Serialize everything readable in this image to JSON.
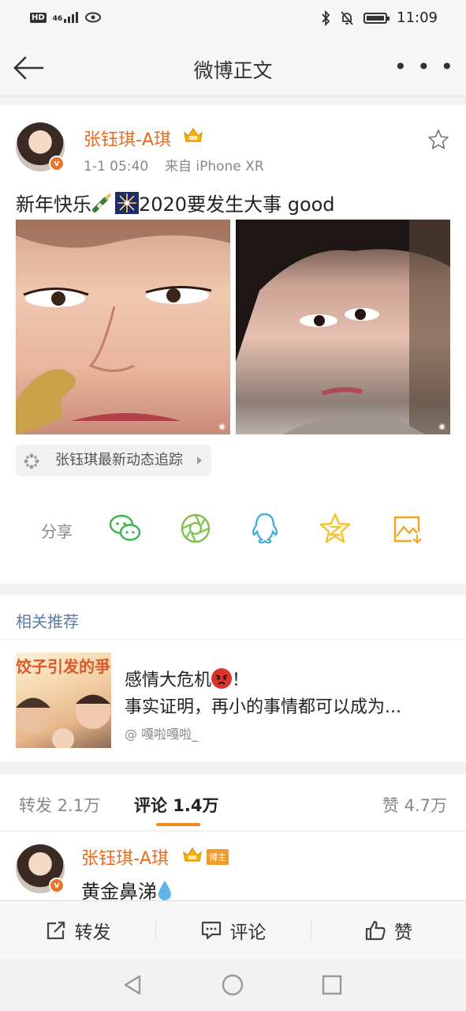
{
  "status_bar": {
    "network": "HD",
    "signal": "46",
    "time": "11:09"
  },
  "nav": {
    "title": "微博正文",
    "more": "• • •"
  },
  "post": {
    "username": "张钰琪-A琪",
    "time": "1-1 05:40",
    "source": "来自 iPhone XR",
    "text_before": "新年快乐",
    "text_after": "2020要发生大事 good",
    "super_topic": "张钰琪最新动态追踪",
    "share_label": "分享",
    "share_icons": [
      "wechat-icon",
      "moments-icon",
      "qq-icon",
      "qzone-icon",
      "save-image-icon"
    ]
  },
  "recommend": {
    "title": "相关推荐",
    "thumb_text": "饺子引发的爭",
    "line1_before": "感情大危机",
    "line1_after": "！",
    "line2": "事实证明，再小的事情都可以成为...",
    "source": "@ 嘎啦嘎啦_"
  },
  "tabs": [
    {
      "label": "转发 2.1万"
    },
    {
      "label": "评论 1.4万"
    },
    {
      "label": "赞 4.7万"
    }
  ],
  "comment": {
    "username": "张钰琪-A琪",
    "badge": "博主",
    "text": "黄金鼻涕"
  },
  "actions": {
    "repost": "转发",
    "comment": "评论",
    "like": "赞"
  },
  "colors": {
    "accent": "#f28a1c",
    "username": "#e86b1f",
    "link": "#5b7ea9"
  }
}
